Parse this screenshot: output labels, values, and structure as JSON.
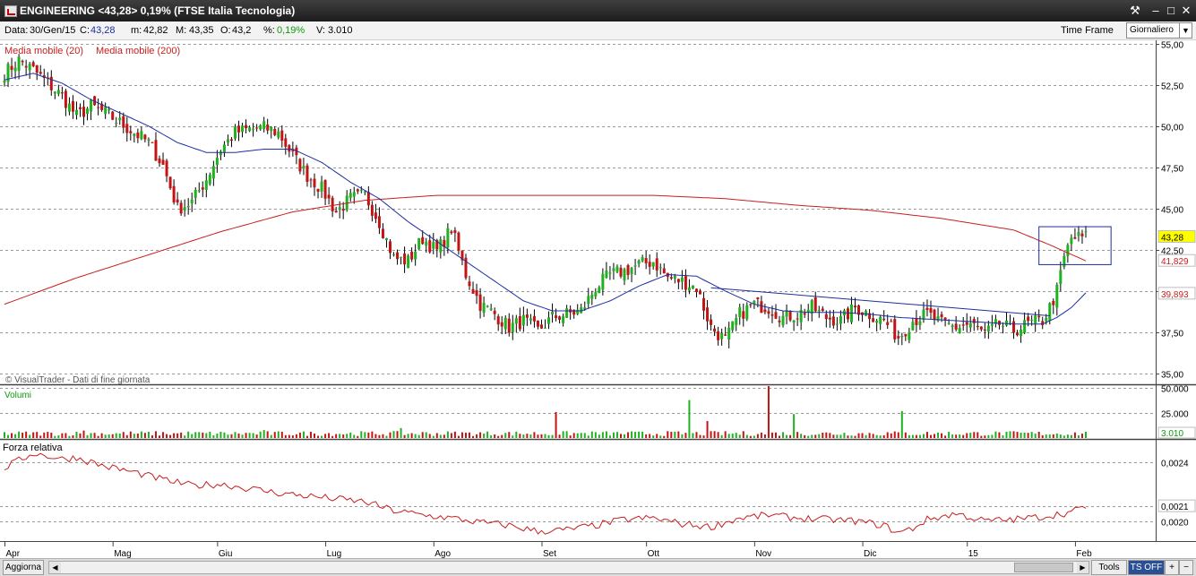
{
  "window": {
    "title": "ENGINEERING <43,28> 0,19% (FTSE Italia Tecnologia)",
    "tools_icon": "wrench-icon",
    "minimize_icon": "minimize-icon",
    "restore_icon": "restore-icon",
    "close_icon": "close-icon"
  },
  "info": {
    "data_label": "Data:",
    "data_value": "30/Gen/15",
    "c_label": "C:",
    "c_value": "43,28",
    "m_label": "m:",
    "m_value": "42,82",
    "M_label": "M:",
    "M_value": "43,35",
    "o_label": "O:",
    "o_value": "43,2",
    "pct_label": "%:",
    "pct_value": "0,19%",
    "v_label": "V:",
    "v_value": "3.010",
    "time_frame_label": "Time Frame",
    "time_frame_value": "Giornaliero"
  },
  "bottom": {
    "refresh_button": "Aggiorna",
    "tools_button": "Tools",
    "ts_button": "TS OFF",
    "plus_icon": "plus-icon",
    "minus_icon": "minus-icon"
  },
  "colors": {
    "up": "#1fb21f",
    "down": "#c21414",
    "ma20": "#1c2f9e",
    "ma200": "#c81e1e",
    "grid": "#9a9a9a",
    "highlight": "#ffff00"
  },
  "chart_data": [
    {
      "type": "candlestick",
      "panel": "price",
      "credit": "© VisualTrader - Dati di fine giornata",
      "legend": [
        "Media mobile (20)",
        "Media mobile (200)"
      ],
      "legend_placement": "top-left",
      "x_ticks": [
        "Apr",
        "Mag",
        "Giu",
        "Lug",
        "Ago",
        "Set",
        "Ott",
        "Nov",
        "Dic",
        "15",
        "Feb"
      ],
      "y_ticks": [
        "55,00",
        "52,50",
        "50,00",
        "47,50",
        "45,00",
        "42,50",
        "40,00",
        "37,50",
        "35,00"
      ],
      "ylim": [
        34.4,
        55.2
      ],
      "grid": true,
      "last_labels": {
        "close": "43,28",
        "ma20": "39,893",
        "ma200": "41,829"
      },
      "close_anchors": [
        [
          0,
          53.2
        ],
        [
          4,
          54.0
        ],
        [
          8,
          53.4
        ],
        [
          12,
          52.6
        ],
        [
          16,
          51.8
        ],
        [
          20,
          50.6
        ],
        [
          24,
          51.2
        ],
        [
          28,
          50.8
        ],
        [
          32,
          50.2
        ],
        [
          36,
          49.6
        ],
        [
          40,
          49.0
        ],
        [
          44,
          47.6
        ],
        [
          48,
          45.0
        ],
        [
          52,
          45.4
        ],
        [
          56,
          46.8
        ],
        [
          60,
          48.6
        ],
        [
          64,
          49.6
        ],
        [
          68,
          49.8
        ],
        [
          72,
          49.9
        ],
        [
          76,
          49.6
        ],
        [
          80,
          48.2
        ],
        [
          84,
          47.0
        ],
        [
          88,
          46.2
        ],
        [
          92,
          44.8
        ],
        [
          96,
          45.6
        ],
        [
          100,
          45.8
        ],
        [
          104,
          44.2
        ],
        [
          108,
          42.0
        ],
        [
          112,
          41.8
        ],
        [
          116,
          43.2
        ],
        [
          120,
          42.4
        ],
        [
          124,
          43.8
        ],
        [
          128,
          41.0
        ],
        [
          132,
          39.2
        ],
        [
          136,
          38.6
        ],
        [
          140,
          37.8
        ],
        [
          144,
          38.2
        ],
        [
          148,
          37.6
        ],
        [
          152,
          38.4
        ],
        [
          156,
          38.6
        ],
        [
          160,
          38.8
        ],
        [
          164,
          40.2
        ],
        [
          168,
          41.0
        ],
        [
          172,
          41.2
        ],
        [
          176,
          41.6
        ],
        [
          180,
          41.8
        ],
        [
          184,
          40.8
        ],
        [
          188,
          40.6
        ],
        [
          192,
          40.2
        ],
        [
          196,
          37.8
        ],
        [
          200,
          37.0
        ],
        [
          204,
          38.6
        ],
        [
          208,
          39.2
        ],
        [
          212,
          39.0
        ],
        [
          216,
          38.4
        ],
        [
          220,
          38.6
        ],
        [
          224,
          39.0
        ],
        [
          228,
          38.4
        ],
        [
          232,
          38.2
        ],
        [
          236,
          39.0
        ],
        [
          240,
          38.6
        ],
        [
          244,
          38.2
        ],
        [
          248,
          37.2
        ],
        [
          252,
          38.2
        ],
        [
          256,
          38.6
        ],
        [
          260,
          38.0
        ],
        [
          264,
          37.8
        ],
        [
          268,
          38.0
        ],
        [
          272,
          37.4
        ],
        [
          276,
          38.0
        ],
        [
          280,
          37.6
        ],
        [
          284,
          38.0
        ],
        [
          288,
          38.2
        ],
        [
          290,
          39.0
        ],
        [
          292,
          40.0
        ],
        [
          294,
          42.0
        ],
        [
          296,
          43.2
        ],
        [
          300,
          43.28
        ]
      ],
      "ma20_anchors": [
        [
          0,
          52.8
        ],
        [
          8,
          53.2
        ],
        [
          16,
          52.6
        ],
        [
          24,
          51.6
        ],
        [
          32,
          50.8
        ],
        [
          40,
          50.0
        ],
        [
          48,
          49.0
        ],
        [
          56,
          48.4
        ],
        [
          64,
          48.4
        ],
        [
          72,
          48.6
        ],
        [
          80,
          48.6
        ],
        [
          88,
          47.8
        ],
        [
          96,
          46.6
        ],
        [
          104,
          45.6
        ],
        [
          112,
          44.2
        ],
        [
          120,
          43.0
        ],
        [
          128,
          41.8
        ],
        [
          136,
          40.6
        ],
        [
          144,
          39.4
        ],
        [
          152,
          38.8
        ],
        [
          160,
          38.8
        ],
        [
          168,
          39.4
        ],
        [
          176,
          40.3
        ],
        [
          184,
          41.0
        ],
        [
          192,
          40.9
        ],
        [
          200,
          40.0
        ],
        [
          208,
          39.2
        ],
        [
          216,
          38.8
        ],
        [
          224,
          38.7
        ],
        [
          232,
          38.7
        ],
        [
          240,
          38.6
        ],
        [
          248,
          38.4
        ],
        [
          256,
          38.3
        ],
        [
          264,
          38.2
        ],
        [
          272,
          38.1
        ],
        [
          280,
          38.0
        ],
        [
          288,
          38.0
        ],
        [
          292,
          38.4
        ],
        [
          296,
          39.0
        ],
        [
          300,
          39.893
        ]
      ],
      "ma200_anchors": [
        [
          0,
          39.2
        ],
        [
          20,
          40.8
        ],
        [
          40,
          42.2
        ],
        [
          60,
          43.6
        ],
        [
          80,
          44.8
        ],
        [
          100,
          45.5
        ],
        [
          120,
          45.8
        ],
        [
          140,
          45.8
        ],
        [
          160,
          45.8
        ],
        [
          180,
          45.8
        ],
        [
          200,
          45.6
        ],
        [
          220,
          45.2
        ],
        [
          240,
          44.9
        ],
        [
          260,
          44.4
        ],
        [
          280,
          43.7
        ],
        [
          290,
          42.8
        ],
        [
          300,
          41.829
        ]
      ],
      "annotations": [
        {
          "type": "box",
          "x": [
            287,
            307
          ],
          "y": [
            41.6,
            43.9
          ]
        },
        {
          "type": "trendline",
          "x": [
            196,
            290
          ],
          "y": [
            40.2,
            38.5
          ]
        }
      ]
    },
    {
      "type": "bar",
      "panel": "volume",
      "title": "Volumi",
      "y_ticks": [
        "50.000",
        "25.000"
      ],
      "ylim": [
        0,
        52000
      ],
      "last_label": "3.010",
      "spikes": [
        [
          22,
          7500
        ],
        [
          72,
          8000
        ],
        [
          110,
          10000
        ],
        [
          153,
          26000
        ],
        [
          190,
          38000
        ],
        [
          195,
          17000
        ],
        [
          212,
          52000
        ],
        [
          219,
          24000
        ],
        [
          249,
          27000
        ]
      ]
    },
    {
      "type": "line",
      "panel": "relative_strength",
      "title": "Forza relativa",
      "y_ticks": [
        "0,0024",
        "0,0021",
        "0,0020"
      ],
      "ylim": [
        0.00187,
        0.00255
      ],
      "last_label": "0,0021",
      "anchors": [
        [
          0,
          0.00236
        ],
        [
          8,
          0.00246
        ],
        [
          16,
          0.00242
        ],
        [
          20,
          0.00243
        ],
        [
          28,
          0.00237
        ],
        [
          36,
          0.00233
        ],
        [
          44,
          0.00228
        ],
        [
          52,
          0.00224
        ],
        [
          60,
          0.00225
        ],
        [
          68,
          0.00222
        ],
        [
          76,
          0.00219
        ],
        [
          84,
          0.00217
        ],
        [
          92,
          0.00215
        ],
        [
          100,
          0.00213
        ],
        [
          108,
          0.00207
        ],
        [
          116,
          0.00204
        ],
        [
          124,
          0.00202
        ],
        [
          132,
          0.00199
        ],
        [
          140,
          0.00197
        ],
        [
          148,
          0.00193
        ],
        [
          156,
          0.00194
        ],
        [
          164,
          0.00197
        ],
        [
          172,
          0.00201
        ],
        [
          180,
          0.00202
        ],
        [
          188,
          0.00198
        ],
        [
          196,
          0.00196
        ],
        [
          204,
          0.00202
        ],
        [
          212,
          0.00204
        ],
        [
          220,
          0.00202
        ],
        [
          228,
          0.00201
        ],
        [
          236,
          0.002
        ],
        [
          244,
          0.00197
        ],
        [
          248,
          0.00192
        ],
        [
          252,
          0.00195
        ],
        [
          256,
          0.00201
        ],
        [
          264,
          0.00205
        ],
        [
          272,
          0.002
        ],
        [
          280,
          0.00201
        ],
        [
          288,
          0.00203
        ],
        [
          296,
          0.00206
        ],
        [
          300,
          0.0021
        ]
      ]
    }
  ]
}
